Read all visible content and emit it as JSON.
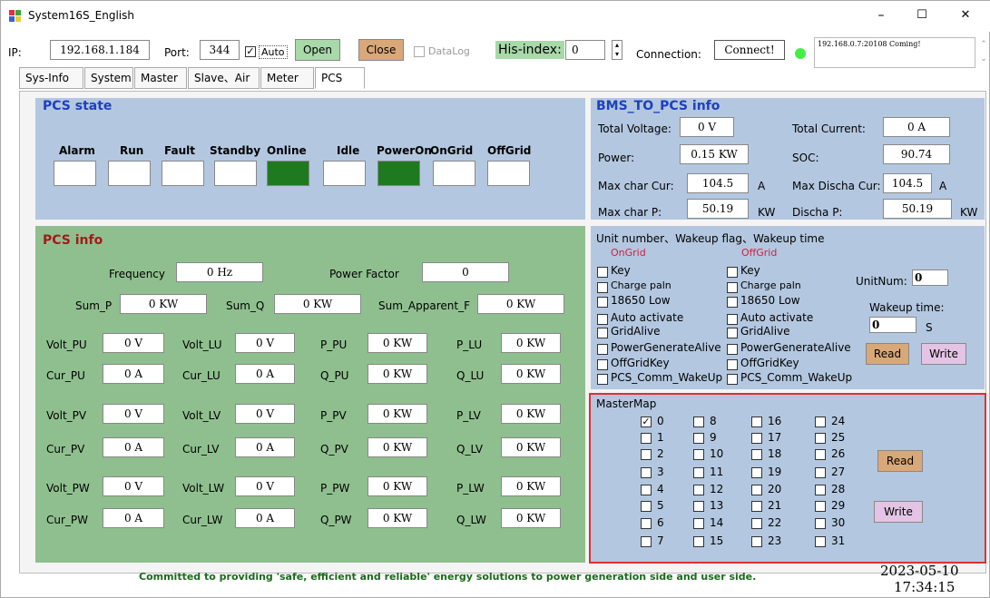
{
  "window": {
    "title": "System16S_English",
    "minimize": "–",
    "maximize": "☐",
    "close": "✕"
  },
  "toolbar": {
    "ip_label": "IP:",
    "ip_value": "192.168.1.184",
    "port_label": "Port:",
    "port_value": "344",
    "auto_label": "Auto",
    "open": "Open",
    "close": "Close",
    "datalog": "DataLog",
    "his_label": "His-index:",
    "his_value": "0",
    "connection_label": "Connection:",
    "connect": "Connect!",
    "log_text": "192.168.0.7:20108 Coming!"
  },
  "tabs": [
    "Sys-Info",
    "System",
    "Master",
    "Slave、Air",
    "Meter",
    "PCS"
  ],
  "pcs_state": {
    "title": "PCS state",
    "items": [
      {
        "label": "Alarm",
        "on": false
      },
      {
        "label": "Run",
        "on": false
      },
      {
        "label": "Fault",
        "on": false
      },
      {
        "label": "Standby",
        "on": false
      },
      {
        "label": "Online",
        "on": true
      },
      {
        "label": "Idle",
        "on": false
      },
      {
        "label": "PowerOn",
        "on": true
      },
      {
        "label": "OnGrid",
        "on": false
      },
      {
        "label": "OffGrid",
        "on": false
      }
    ]
  },
  "bms": {
    "title": "BMS_TO_PCS info",
    "total_voltage_label": "Total Voltage:",
    "total_voltage": "0 V",
    "total_current_label": "Total Current:",
    "total_current": "0 A",
    "power_label": "Power:",
    "power": "0.15 KW",
    "soc_label": "SOC:",
    "soc": "90.74",
    "max_char_cur_label": "Max char Cur:",
    "max_char_cur": "104.5",
    "max_char_cur_unit": "A",
    "max_discha_cur_label": "Max Discha Cur:",
    "max_discha_cur": "104.5",
    "max_discha_cur_unit": "A",
    "max_char_p_label": "Max char P:",
    "max_char_p": "50.19",
    "max_char_p_unit": "KW",
    "discha_p_label": "Discha P:",
    "discha_p": "50.19",
    "discha_p_unit": "KW"
  },
  "pcs_info": {
    "title": "PCS info",
    "frequency_label": "Frequency",
    "frequency": "0 Hz",
    "pf_label": "Power Factor",
    "pf": "0",
    "sum_p_label": "Sum_P",
    "sum_p": "0 KW",
    "sum_q_label": "Sum_Q",
    "sum_q": "0 KW",
    "sum_app_label": "Sum_Apparent_F",
    "sum_app": "0 KW",
    "rows": [
      [
        {
          "l": "Volt_PU",
          "v": "0 V"
        },
        {
          "l": "Volt_LU",
          "v": "0 V"
        },
        {
          "l": "P_PU",
          "v": "0 KW"
        },
        {
          "l": "P_LU",
          "v": "0 KW"
        }
      ],
      [
        {
          "l": "Cur_PU",
          "v": "0 A"
        },
        {
          "l": "Cur_LU",
          "v": "0 A"
        },
        {
          "l": "Q_PU",
          "v": "0 KW"
        },
        {
          "l": "Q_LU",
          "v": "0 KW"
        }
      ],
      [
        {
          "l": "Volt_PV",
          "v": "0 V"
        },
        {
          "l": "Volt_LV",
          "v": "0 V"
        },
        {
          "l": "P_PV",
          "v": "0 KW"
        },
        {
          "l": "P_LV",
          "v": "0 KW"
        }
      ],
      [
        {
          "l": "Cur_PV",
          "v": "0 A"
        },
        {
          "l": "Cur_LV",
          "v": "0 A"
        },
        {
          "l": "Q_PV",
          "v": "0 KW"
        },
        {
          "l": "Q_LV",
          "v": "0 KW"
        }
      ],
      [
        {
          "l": "Volt_PW",
          "v": "0 V"
        },
        {
          "l": "Volt_LW",
          "v": "0 V"
        },
        {
          "l": "P_PW",
          "v": "0 KW"
        },
        {
          "l": "P_LW",
          "v": "0 KW"
        }
      ],
      [
        {
          "l": "Cur_PW",
          "v": "0 A"
        },
        {
          "l": "Cur_LW",
          "v": "0 A"
        },
        {
          "l": "Q_PW",
          "v": "0 KW"
        },
        {
          "l": "Q_LW",
          "v": "0 KW"
        }
      ]
    ]
  },
  "unit": {
    "title": "Unit number、Wakeup flag、Wakeup time",
    "ongrid": "OnGrid",
    "offgrid": "OffGrid",
    "flags": [
      "Key",
      "Charge paln",
      "18650 Low",
      "Auto activate",
      "GridAlive",
      "PowerGenerateAlive",
      "OffGridKey",
      "PCS_Comm_WakeUp"
    ],
    "unitnum_label": "UnitNum:",
    "unitnum": "0",
    "wakeup_label": "Wakeup time:",
    "wakeup": "0",
    "wakeup_unit": "S",
    "read": "Read",
    "write": "Write"
  },
  "mastermap": {
    "title": "MasterMap",
    "checked": [
      0
    ],
    "read": "Read",
    "write": "Write"
  },
  "footer": {
    "slogan": "Committed to providing 'safe, efficient and reliable' energy solutions to power generation side and user side.",
    "date": "2023-05-10",
    "time": "17:34:15"
  },
  "colors": {
    "blue_panel": "#b3c7e0",
    "green_panel": "#8fbf8f",
    "title_blue": "#1f3fbf",
    "title_red": "#a31a1a",
    "status_on": "#1f7a1f",
    "highlight": "#e03030"
  }
}
